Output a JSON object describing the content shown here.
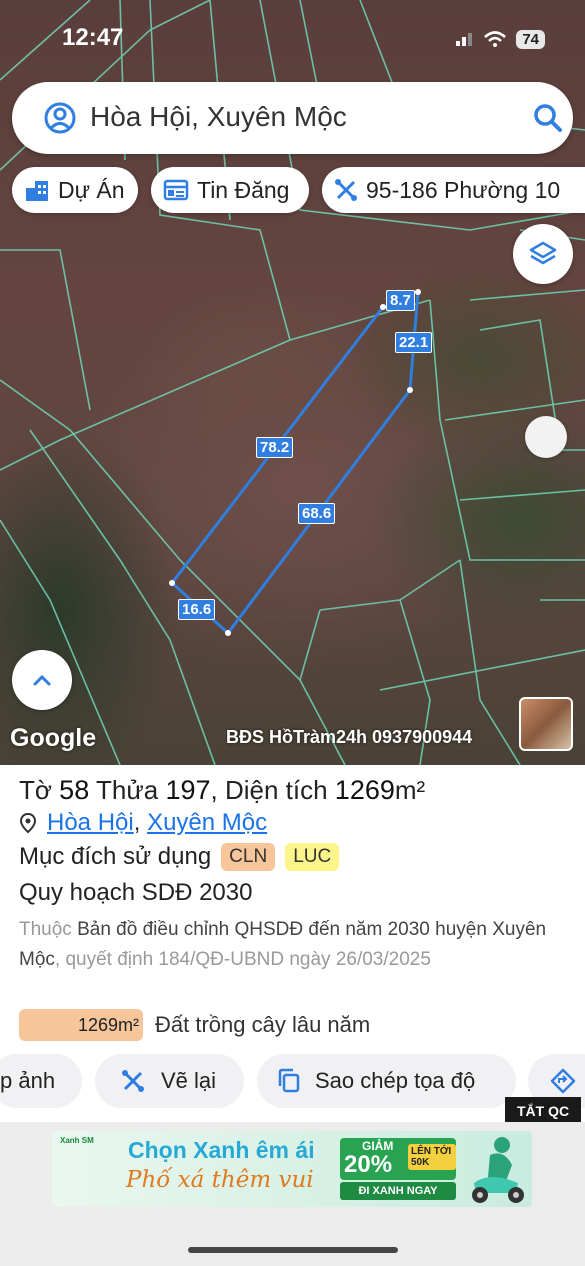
{
  "status": {
    "time": "12:47",
    "battery": "74"
  },
  "search": {
    "query": "Hòa Hội, Xuyên Mộc"
  },
  "chips": [
    {
      "label": "Dự Án",
      "icon": "building-icon"
    },
    {
      "label": "Tin Đăng",
      "icon": "listing-icon"
    },
    {
      "label": "95-186 Phường 10",
      "icon": "ruler-icon"
    }
  ],
  "map": {
    "google": "Google",
    "watermark": "BĐS HồTràm24h 0937900944",
    "segments": [
      "8.7",
      "22.1",
      "78.2",
      "68.6",
      "16.6"
    ],
    "line_color": "#2f7ee0"
  },
  "parcel": {
    "title_prefix": "Tờ",
    "sheet_no": "58",
    "plot_label": "Thửa",
    "plot_no": "197",
    "area_label": ", Diện tích",
    "area_value": "1269",
    "area_unit": "m²",
    "commune": "Hòa Hội",
    "district": "Xuyên Mộc",
    "purpose_label": "Mục đích sử dụng",
    "purpose_tags": [
      {
        "code": "CLN",
        "color": "#f7c59a"
      },
      {
        "code": "LUC",
        "color": "#fdf58a"
      }
    ],
    "plan_title": "Quy hoạch SDĐ 2030",
    "desc_prefix": "Thuộc",
    "desc_main": "Bản đồ điều chỉnh QHSDĐ đến năm 2030 huyện Xuyên Mộc",
    "desc_suffix": ", quyết định 184/QĐ-UBND ngày 26/03/2025",
    "legend_value": "1269m²",
    "legend_label": "Đất trồng cây lâu năm"
  },
  "actions": {
    "photo": "p ảnh",
    "redraw": "Vẽ lại",
    "copy": "Sao chép tọa độ"
  },
  "ad": {
    "close": "TẮT QC",
    "brand": "Xanh SM",
    "headline": "Chọn Xanh êm ái",
    "tagline": "Phố xá thêm vui",
    "discount_label": "GIẢM",
    "discount": "20%",
    "max": "LÊN TỚI 50K",
    "cta": "ĐI XANH NGAY"
  }
}
